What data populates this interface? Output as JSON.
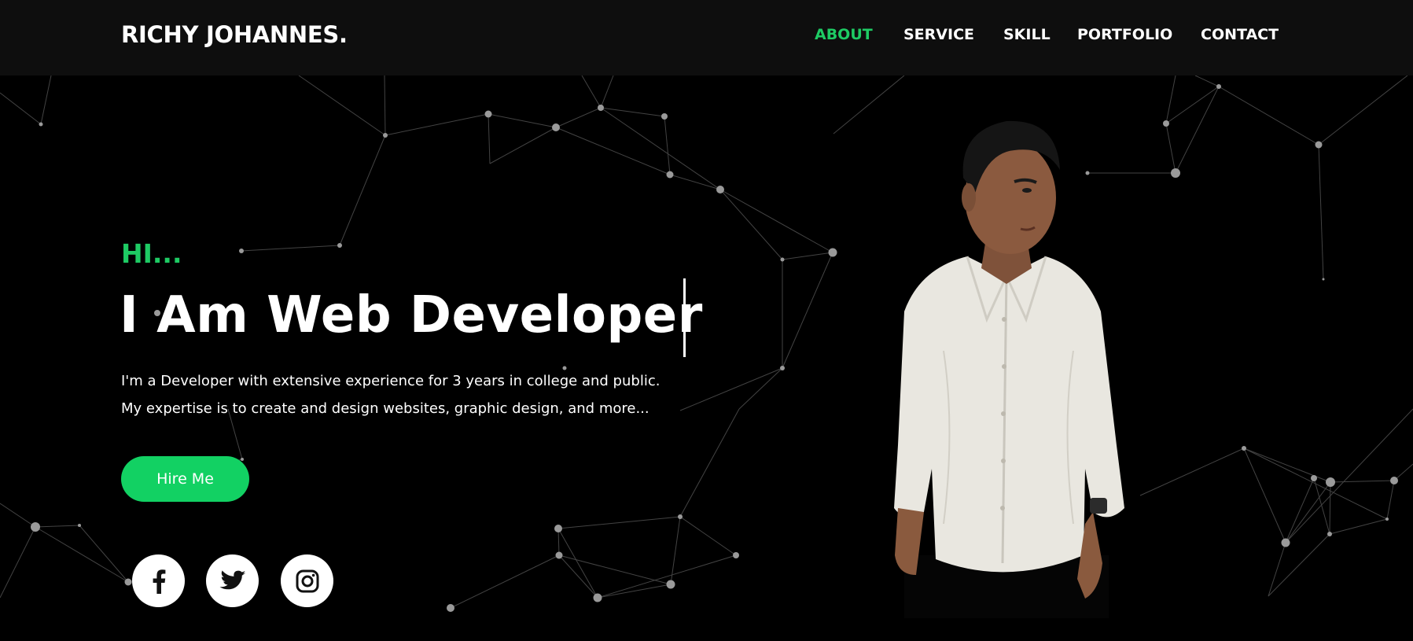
{
  "header": {
    "logo": "RICHY JOHANNES.",
    "nav": [
      {
        "label": "ABOUT",
        "active": true
      },
      {
        "label": "SERVICE",
        "active": false
      },
      {
        "label": "SKILL",
        "active": false
      },
      {
        "label": "PORTFOLIO",
        "active": false
      },
      {
        "label": "CONTACT",
        "active": false
      }
    ]
  },
  "hero": {
    "greeting": "HI...",
    "headline": "I Am Web Developer",
    "bio_line1": "I'm a Developer with extensive experience for 3 years in college and public.",
    "bio_line2": "My expertise is to create and design websites, graphic design, and more...",
    "cta_label": "Hire Me",
    "social": [
      "facebook-icon",
      "twitter-icon",
      "instagram-icon"
    ]
  },
  "colors": {
    "accent": "#1ecb64",
    "button": "#12d163",
    "background": "#000000",
    "navbar": "#0e0e0e",
    "text": "#ffffff"
  }
}
